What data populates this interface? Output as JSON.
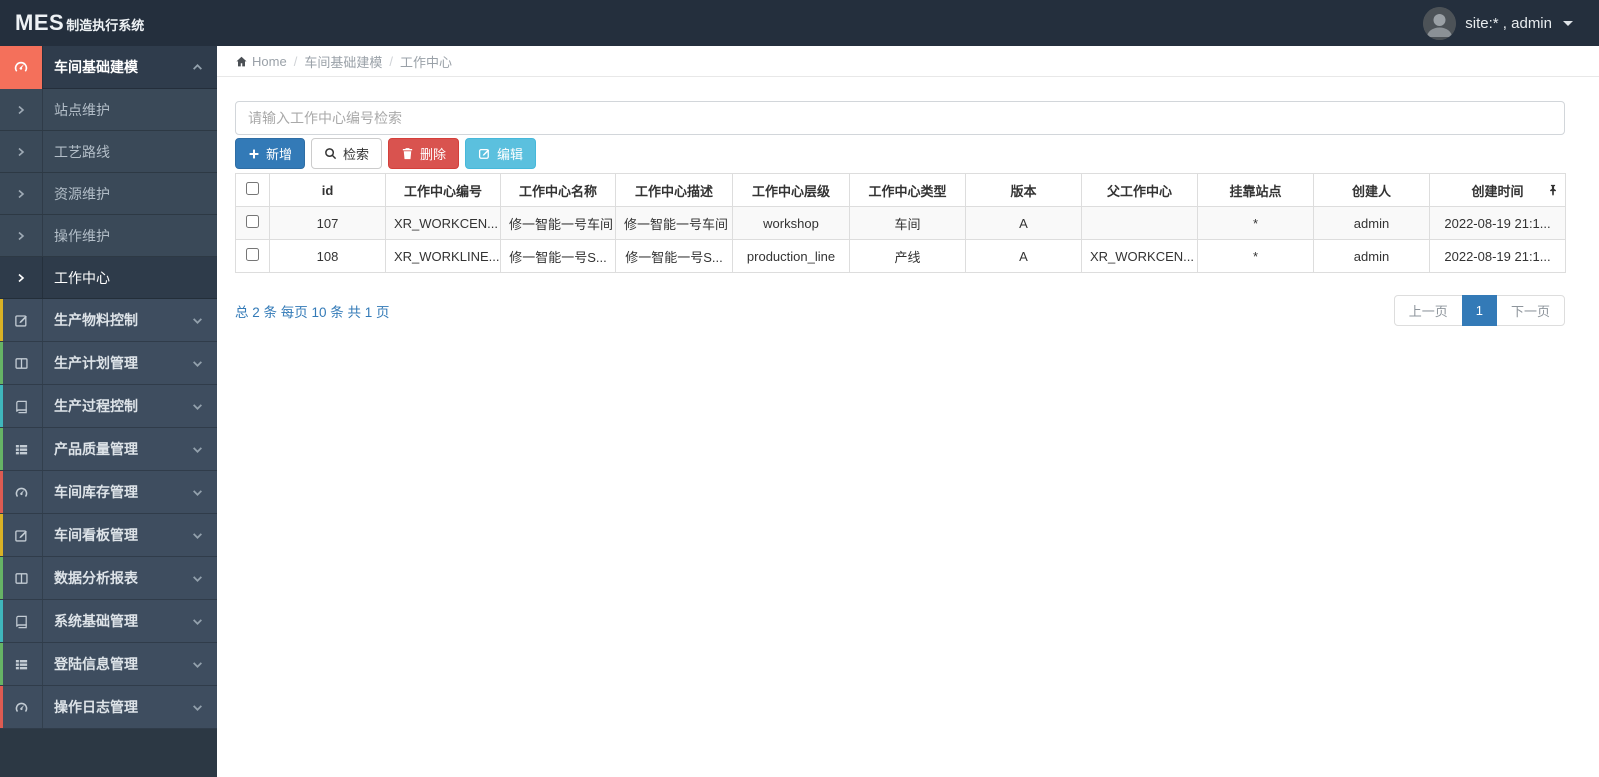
{
  "navbar": {
    "brand": {
      "primary": "MES",
      "secondary": "制造执行系统"
    },
    "user": {
      "label": "site:* , admin",
      "avatar_icon": "user-avatar",
      "caret_icon": "caret-down-icon"
    }
  },
  "sidebar": {
    "group": {
      "label": "车间基础建模",
      "icon": "gauge-icon",
      "state_icon": "chevron-up-icon",
      "icon_bg": "#f4705b"
    },
    "sub_items": [
      {
        "label": "站点维护",
        "active": false
      },
      {
        "label": "工艺路线",
        "active": false
      },
      {
        "label": "资源维护",
        "active": false
      },
      {
        "label": "操作维护",
        "active": false
      },
      {
        "label": "工作中心",
        "active": true
      }
    ],
    "items": [
      {
        "label": "生产物料控制",
        "icon": "edit-square-icon",
        "strip_color": "#d9b125"
      },
      {
        "label": "生产计划管理",
        "icon": "columns-icon",
        "strip_color": "#66b365"
      },
      {
        "label": "生产过程控制",
        "icon": "book-icon",
        "strip_color": "#3fb6bc"
      },
      {
        "label": "产品质量管理",
        "icon": "list-icon",
        "strip_color": "#66b365"
      },
      {
        "label": "车间库存管理",
        "icon": "gauge-icon",
        "strip_color": "#dd5b52"
      },
      {
        "label": "车间看板管理",
        "icon": "edit-square-icon",
        "strip_color": "#d9b125"
      },
      {
        "label": "数据分析报表",
        "icon": "columns-icon",
        "strip_color": "#66b365"
      },
      {
        "label": "系统基础管理",
        "icon": "book-icon",
        "strip_color": "#3fb6bc"
      },
      {
        "label": "登陆信息管理",
        "icon": "list-icon",
        "strip_color": "#66b365"
      },
      {
        "label": "操作日志管理",
        "icon": "gauge-icon",
        "strip_color": "#dd5b52"
      }
    ]
  },
  "breadcrumb": {
    "home": "Home",
    "separator": "/",
    "items": [
      "车间基础建模",
      "工作中心"
    ]
  },
  "toolbar": {
    "search_placeholder": "请输入工作中心编号检索",
    "buttons": [
      {
        "label": "新增",
        "icon": "plus-icon",
        "style": "primary",
        "color": "#337ab7"
      },
      {
        "label": "检索",
        "icon": "search-icon",
        "style": "default",
        "color": "#ffffff"
      },
      {
        "label": "删除",
        "icon": "trash-icon",
        "style": "danger",
        "color": "#d9534f"
      },
      {
        "label": "编辑",
        "icon": "edit-icon",
        "style": "info",
        "color": "#5bc0de"
      }
    ]
  },
  "table": {
    "columns": [
      "id",
      "工作中心编号",
      "工作中心名称",
      "工作中心描述",
      "工作中心层级",
      "工作中心类型",
      "版本",
      "父工作中心",
      "挂靠站点",
      "创建人",
      "创建时间"
    ],
    "pin_icon": "pin-icon",
    "rows": [
      [
        "107",
        "XR_WORKCEN...",
        "修一智能一号车间",
        "修一智能一号车间",
        "workshop",
        "车间",
        "A",
        "",
        "*",
        "admin",
        "2022-08-19 21:1..."
      ],
      [
        "108",
        "XR_WORKLINE...",
        "修一智能一号S...",
        "修一智能一号S...",
        "production_line",
        "产线",
        "A",
        "XR_WORKCEN...",
        "*",
        "admin",
        "2022-08-19 21:1..."
      ]
    ]
  },
  "pagination": {
    "summary": "总 2 条 每页 10 条 共 1 页",
    "prev": "上一页",
    "current": "1",
    "next": "下一页"
  },
  "colors": {
    "navbar_bg": "#242f3d",
    "sidebar_bg": "#3e4d5f",
    "sidebar_active_bg": "#2e3b4a",
    "sidebar_red_block": "#f4705b",
    "primary_blue": "#337ab7",
    "danger_red": "#d9534f",
    "info_cyan": "#5bc0de",
    "strip_yellow": "#d9b125",
    "strip_green": "#66b365",
    "strip_teal": "#3fb6bc",
    "strip_red": "#dd5b52",
    "row_stripe": "#f9f9f9"
  }
}
